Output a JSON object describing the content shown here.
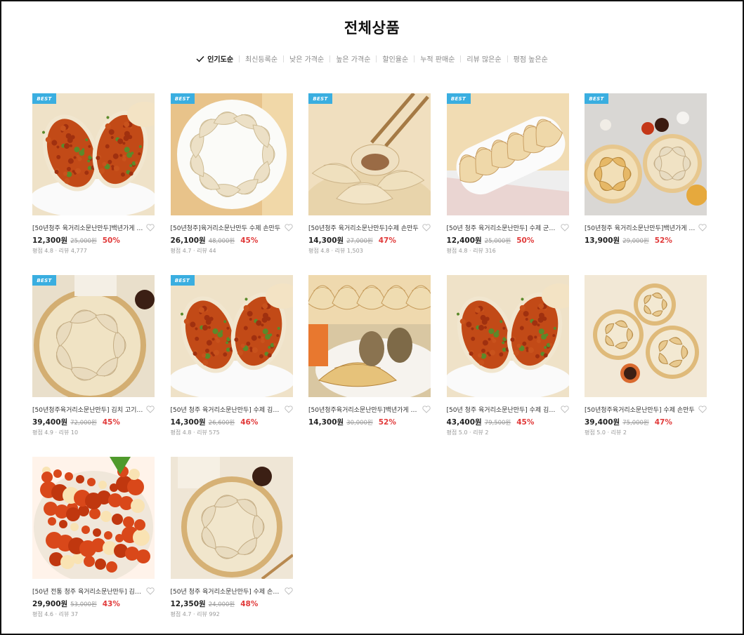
{
  "page_title": "전체상품",
  "sort_options": [
    {
      "label": "인기도순",
      "active": true
    },
    {
      "label": "최신등록순",
      "active": false
    },
    {
      "label": "낮은 가격순",
      "active": false
    },
    {
      "label": "높은 가격순",
      "active": false
    },
    {
      "label": "할인율순",
      "active": false
    },
    {
      "label": "누적 판매순",
      "active": false
    },
    {
      "label": "리뷰 많은순",
      "active": false
    },
    {
      "label": "평점 높은순",
      "active": false
    }
  ],
  "colors": {
    "accent": "#e13a3a",
    "badge": "#3aaee0"
  },
  "products": [
    {
      "name": "[50년청주 육거리소문난만두]백년가게 김치만두",
      "price": "12,300원",
      "original": "25,000원",
      "discount": "50%",
      "rating_label": "평점 4.8",
      "review_label": "리뷰 4,777",
      "best": true,
      "badge": "BEST",
      "image": "kimchi-dumpling-halves"
    },
    {
      "name": "[50년청주]육거리소문난만두 수제 손만두",
      "price": "26,100원",
      "original": "48,000원",
      "discount": "45%",
      "rating_label": "평점 4.7",
      "review_label": "리뷰 44",
      "best": true,
      "badge": "BEST",
      "image": "dumpling-plate-circle"
    },
    {
      "name": "[50년청주 육거리소문난만두]수제 손만두",
      "price": "14,300원",
      "original": "27,000원",
      "discount": "47%",
      "rating_label": "평점 4.8",
      "review_label": "리뷰 1,503",
      "best": true,
      "badge": "BEST",
      "image": "chopsticks-dumpling"
    },
    {
      "name": "[50년 청주 육거리소문난만두] 수제 군만두",
      "price": "12,400원",
      "original": "25,000원",
      "discount": "50%",
      "rating_label": "평점 4.8",
      "review_label": "리뷰 316",
      "best": true,
      "badge": "BEST",
      "image": "fried-dumplings-tray"
    },
    {
      "name": "[50년청주 육거리소문난만두]백년가게 만두",
      "price": "13,900원",
      "original": "29,000원",
      "discount": "52%",
      "rating_label": "",
      "review_label": "",
      "best": true,
      "badge": "BEST",
      "image": "dumplings-with-onion"
    },
    {
      "name": "[50년청주육거리소문난만두] 김치 고기 만두",
      "price": "39,400원",
      "original": "72,000원",
      "discount": "45%",
      "rating_label": "평점 4.9",
      "review_label": "리뷰 10",
      "best": true,
      "badge": "BEST",
      "image": "steamer-basket"
    },
    {
      "name": "[50년 청주 육거리소문난만두] 수제 김치만두",
      "price": "14,300원",
      "original": "26,600원",
      "discount": "46%",
      "rating_label": "평점 4.8",
      "review_label": "리뷰 575",
      "best": true,
      "badge": "BEST",
      "image": "kimchi-dumpling-halves"
    },
    {
      "name": "[50년청주육거리소문난만두]백년가게 군만두",
      "price": "14,300원",
      "original": "30,000원",
      "discount": "52%",
      "rating_label": "",
      "review_label": "",
      "best": false,
      "badge": "",
      "image": "fried-dumpling-cut"
    },
    {
      "name": "[50년 청주 육거리소문난만두] 수제 김치만두",
      "price": "43,400원",
      "original": "79,500원",
      "discount": "45%",
      "rating_label": "평점 5.0",
      "review_label": "리뷰 2",
      "best": false,
      "badge": "",
      "image": "kimchi-dumpling-halves"
    },
    {
      "name": "[50년청주육거리소문난만두] 수제 손만두",
      "price": "39,400원",
      "original": "75,000원",
      "discount": "47%",
      "rating_label": "평점 5.0",
      "review_label": "리뷰 2",
      "best": false,
      "badge": "",
      "image": "three-steamers"
    },
    {
      "name": "[50년 전통 청주 육거리소문난만두] 김치만두",
      "price": "29,900원",
      "original": "53,000원",
      "discount": "43%",
      "rating_label": "평점 4.6",
      "review_label": "리뷰 37",
      "best": false,
      "badge": "",
      "image": "spicy-dumpling-pile"
    },
    {
      "name": "[50년 청주 육거리소문난만두] 수제 손만두",
      "price": "12,350원",
      "original": "24,000원",
      "discount": "48%",
      "rating_label": "평점 4.7",
      "review_label": "리뷰 992",
      "best": false,
      "badge": "",
      "image": "steamer-basket-bag"
    }
  ]
}
